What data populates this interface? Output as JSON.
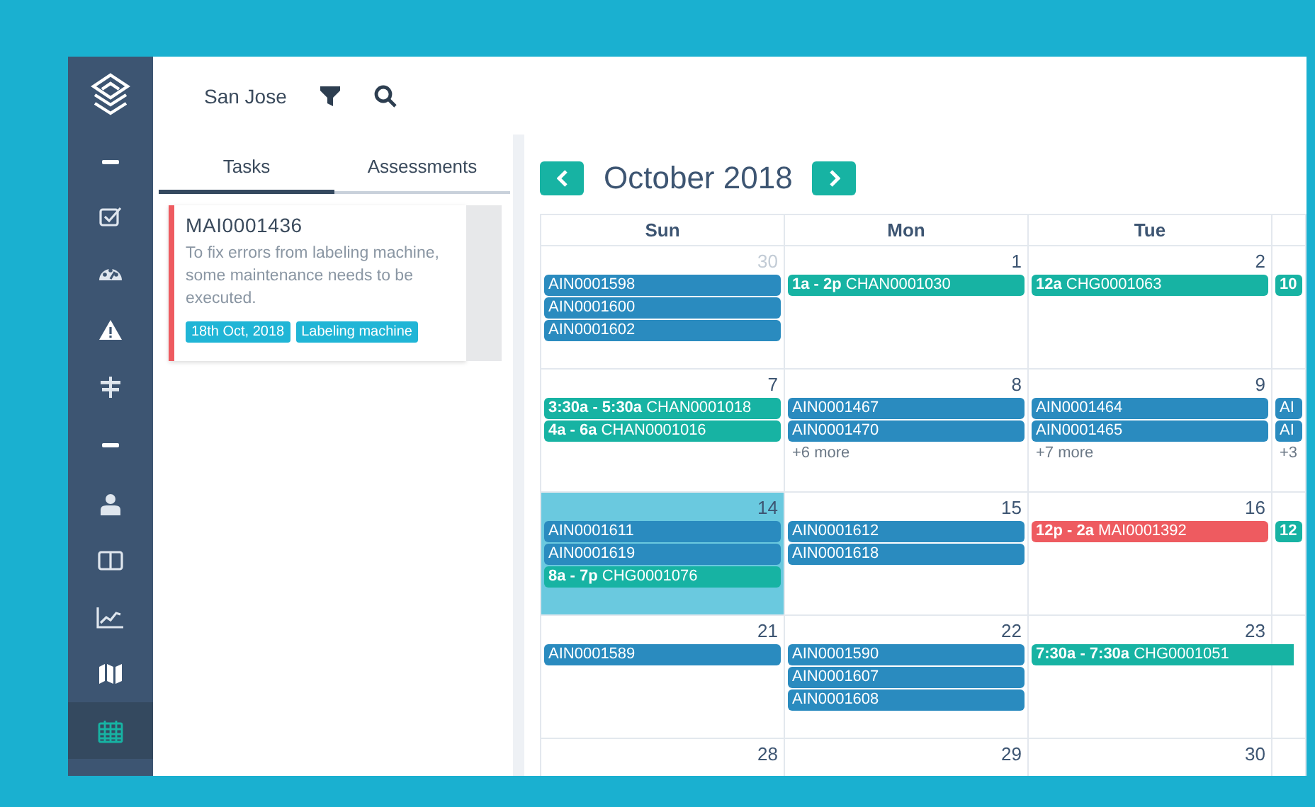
{
  "sidebar": {
    "items": [
      {
        "selected": false
      },
      {
        "selected": false
      },
      {
        "selected": false
      },
      {
        "selected": false
      },
      {
        "selected": false
      },
      {
        "selected": false
      },
      {
        "selected": false
      },
      {
        "selected": false
      },
      {
        "selected": true
      }
    ]
  },
  "top_bar": {
    "location": "San Jose"
  },
  "tabs": [
    {
      "label": "Tasks",
      "selected": true
    },
    {
      "label": "Assessments",
      "selected": false
    }
  ],
  "tasks": [
    {
      "id": "MAI0001436",
      "description": "To fix errors from labeling machine, some maintenance needs to be executed.",
      "tags": [
        "18th Oct, 2018",
        "Labeling machine"
      ]
    }
  ],
  "calendar": {
    "title": "October 2018",
    "weekdays": [
      "Sun",
      "Mon",
      "Tue"
    ],
    "weeks": [
      {
        "days": [
          {
            "date": "30",
            "other_month": true,
            "events": [
              {
                "code": "AIN0001598",
                "color": "#2a8bbf"
              },
              {
                "code": "AIN0001600",
                "color": "#2a8bbf"
              },
              {
                "code": "AIN0001602",
                "color": "#2a8bbf"
              }
            ]
          },
          {
            "date": "1",
            "events": [
              {
                "time": "1a - 2p",
                "code": "CHAN0001030",
                "color": "#17b3a3"
              }
            ]
          },
          {
            "date": "2",
            "events": [
              {
                "time": "12a",
                "code": "CHG0001063",
                "color": "#17b3a3"
              }
            ]
          },
          {
            "events": [
              {
                "time": "10",
                "color": "#17b3a3"
              }
            ]
          }
        ]
      },
      {
        "days": [
          {
            "date": "7",
            "events": [
              {
                "time": "3:30a - 5:30a",
                "code": "CHAN0001018",
                "color": "#17b3a3"
              },
              {
                "time": "4a - 6a",
                "code": "CHAN0001016",
                "color": "#17b3a3"
              }
            ]
          },
          {
            "date": "8",
            "events": [
              {
                "code": "AIN0001467",
                "color": "#2a8bbf"
              },
              {
                "code": "AIN0001470",
                "color": "#2a8bbf"
              }
            ],
            "more": "+6 more"
          },
          {
            "date": "9",
            "events": [
              {
                "code": "AIN0001464",
                "color": "#2a8bbf"
              },
              {
                "code": "AIN0001465",
                "color": "#2a8bbf"
              }
            ],
            "more": "+7 more"
          },
          {
            "events": [
              {
                "code": "AI",
                "color": "#2a8bbf"
              },
              {
                "code": "AI",
                "color": "#2a8bbf"
              }
            ],
            "more": "+3"
          }
        ]
      },
      {
        "days": [
          {
            "date": "14",
            "today": true,
            "events": [
              {
                "code": "AIN0001611",
                "color": "#2a8bbf"
              },
              {
                "code": "AIN0001619",
                "color": "#2a8bbf"
              },
              {
                "time": "8a - 7p",
                "code": "CHG0001076",
                "color": "#17b3a3"
              }
            ]
          },
          {
            "date": "15",
            "events": [
              {
                "code": "AIN0001612",
                "color": "#2a8bbf"
              },
              {
                "code": "AIN0001618",
                "color": "#2a8bbf"
              }
            ]
          },
          {
            "date": "16",
            "events": [
              {
                "time": "12p - 2a",
                "code": "MAI0001392",
                "color": "#ee5b60"
              }
            ]
          },
          {
            "events": [
              {
                "time": "12",
                "color": "#17b3a3"
              }
            ]
          }
        ]
      },
      {
        "days": [
          {
            "date": "21",
            "events": [
              {
                "code": "AIN0001589",
                "color": "#2a8bbf"
              }
            ]
          },
          {
            "date": "22",
            "events": [
              {
                "code": "AIN0001590",
                "color": "#2a8bbf"
              },
              {
                "code": "AIN0001607",
                "color": "#2a8bbf"
              },
              {
                "code": "AIN0001608",
                "color": "#2a8bbf"
              }
            ]
          },
          {
            "date": "23",
            "events": [
              {
                "time": "7:30a - 7:30a",
                "code": "CHG0001051",
                "color": "#17b3a3",
                "continues": true
              }
            ]
          }
        ]
      },
      {
        "days": [
          {
            "date": "28"
          },
          {
            "date": "29"
          },
          {
            "date": "30"
          }
        ]
      }
    ]
  }
}
